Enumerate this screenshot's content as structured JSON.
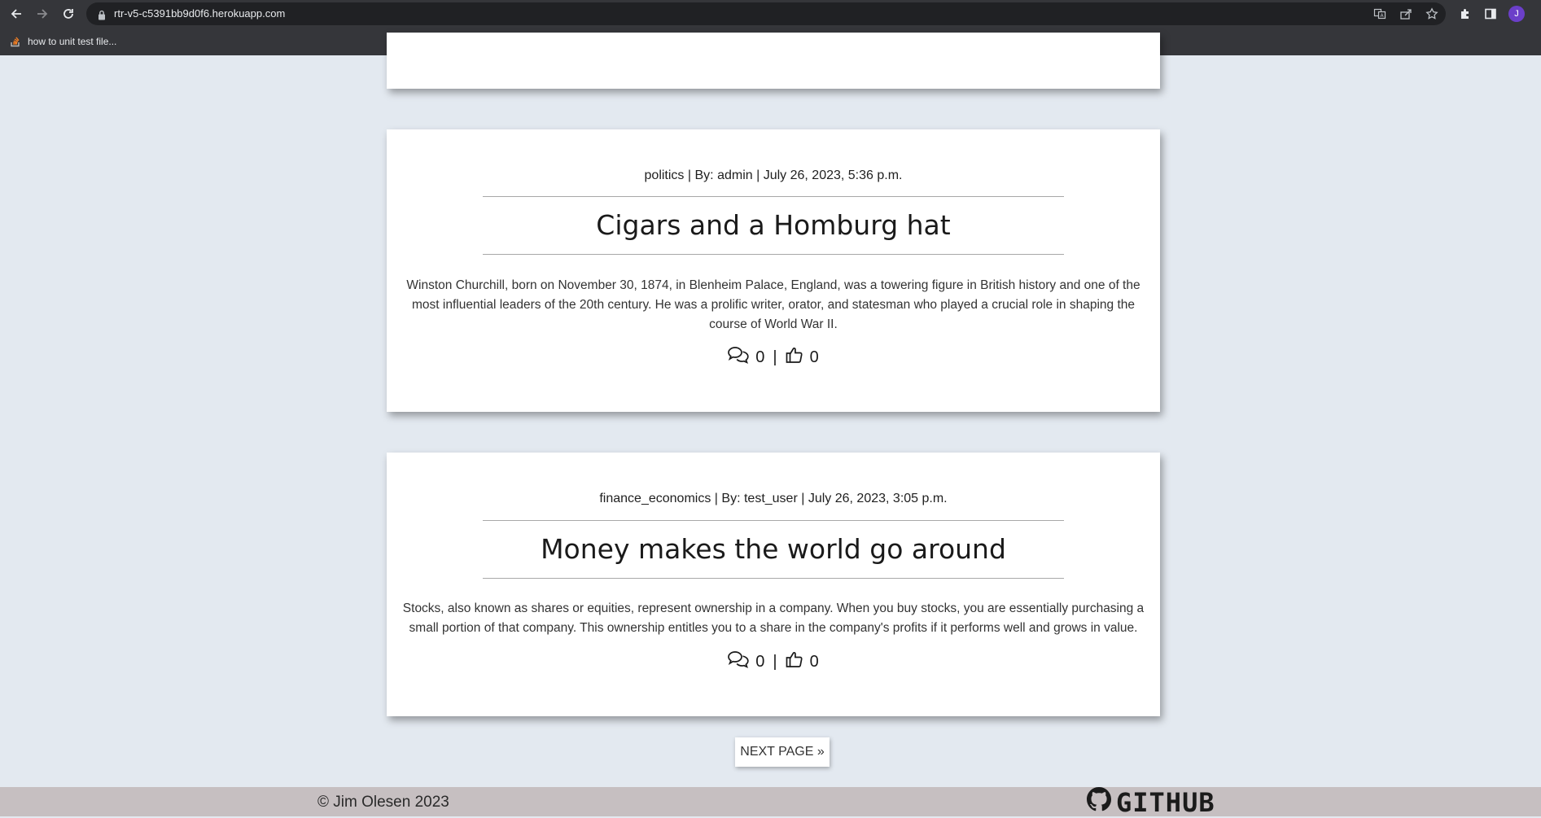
{
  "browser": {
    "url": "rtr-v5-c5391bb9d0f6.herokuapp.com",
    "bookmark_label": "how to unit test file...",
    "profile_initial": "J"
  },
  "posts": [
    {
      "category": "politics",
      "author_prefix": "By:",
      "author": "admin",
      "date": "July 26, 2023, 5:36 p.m.",
      "title": "Cigars and a Homburg hat",
      "excerpt": "Winston Churchill, born on November 30, 1874, in Blenheim Palace, England, was a towering figure in British history and one of the most influential leaders of the 20th century. He was a prolific writer, orator, and statesman who played a crucial role in shaping the course of World War II.",
      "comments": "0",
      "likes": "0"
    },
    {
      "category": "finance_economics",
      "author_prefix": "By:",
      "author": "test_user",
      "date": "July 26, 2023, 3:05 p.m.",
      "title": "Money makes the world go around",
      "excerpt": "Stocks, also known as shares or equities, represent ownership in a company. When you buy stocks, you are essentially purchasing a small portion of that company. This ownership entitles you to a share in the company's profits if it performs well and grows in value.",
      "comments": "0",
      "likes": "0"
    }
  ],
  "pagination": {
    "next_label": "NEXT PAGE »"
  },
  "footer": {
    "copyright": "© Jim Olesen 2023",
    "github_label": "GITHUB"
  }
}
